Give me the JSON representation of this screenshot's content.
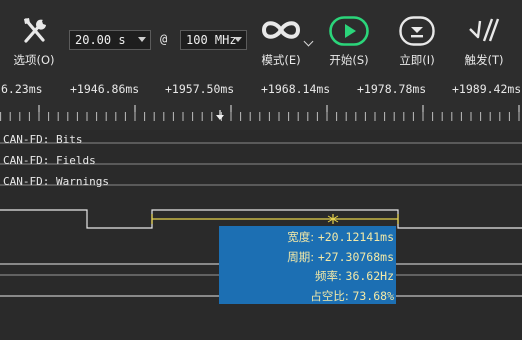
{
  "toolbar": {
    "options_label": "选项(O)",
    "duration_value": "20.00 s",
    "at_symbol": "@",
    "rate_value": "100 MHz",
    "mode_label": "模式(E)",
    "start_label": "开始(S)",
    "immediate_label": "立即(I)",
    "trigger_label": "触发(T)"
  },
  "ruler": {
    "ticks": [
      "6.23ms",
      "+1946.86ms",
      "+1957.50ms",
      "+1968.14ms",
      "+1978.78ms",
      "+1989.42ms"
    ]
  },
  "channels": [
    {
      "label": "CAN-FD: Bits"
    },
    {
      "label": "CAN-FD: Fields"
    },
    {
      "label": "CAN-FD: Warnings"
    }
  ],
  "measurement": {
    "width_key": "宽度: ",
    "width_value": "+20.12141ms",
    "period_key": "周期: ",
    "period_value": "+27.30768ms",
    "freq_key": "频率: ",
    "freq_value": "36.62Hz",
    "duty_key": "占空比: ",
    "duty_value": "73.68%"
  },
  "colors": {
    "background": "#2a2a2a",
    "start_accent": "#2bd57a",
    "measure_bg": "#1c6fb3",
    "measure_text": "#f2e9a8",
    "cursor": "#e8d44d"
  }
}
